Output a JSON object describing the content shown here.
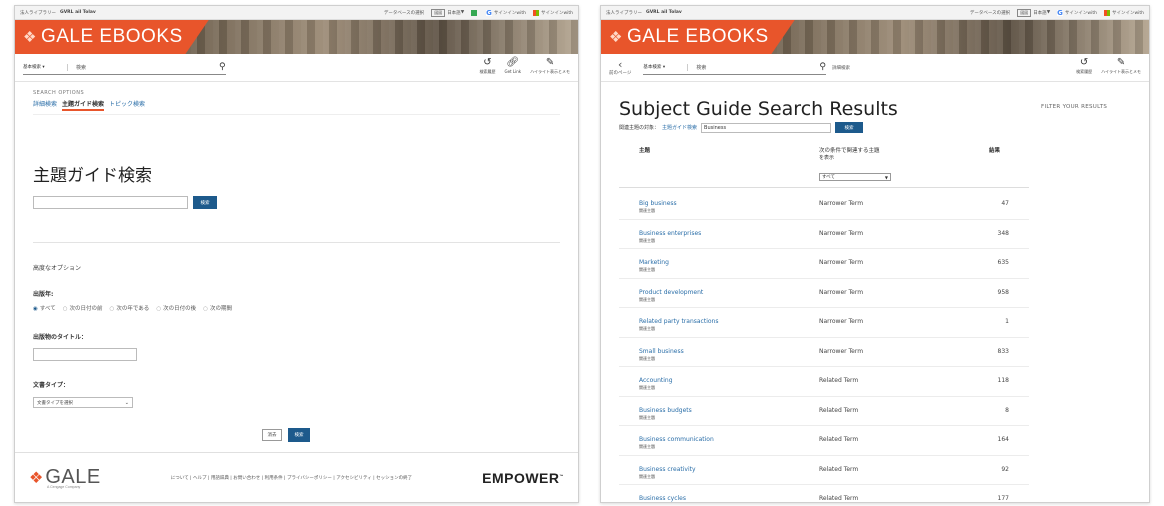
{
  "topbar": {
    "library": "法人ライブラリー",
    "org": "GVRL ail Tolav",
    "db_select": "データベースの選択",
    "lang_icon": "図図",
    "lang": "日本語",
    "signin_google": "サインインwith",
    "signin_ms": "サインインwith"
  },
  "brand": {
    "name": "GALE EBOOKS"
  },
  "left": {
    "search": {
      "type": "基本検索",
      "placeholder": "検索"
    },
    "tools": [
      {
        "icon": "history-icon",
        "label": "検索履歴"
      },
      {
        "icon": "link-icon",
        "label": "Get Link"
      },
      {
        "icon": "pen-icon",
        "label": "ハイライト表示とメモ"
      }
    ],
    "search_options": {
      "caption": "SEARCH OPTIONS",
      "tabs": [
        "詳細検索",
        "主題ガイド検索",
        "トピック検索"
      ],
      "active_tab": 1
    },
    "page_title": "主題ガイド検索",
    "search_button": "検索",
    "advanced_options": "高度なオプション",
    "pub_date": {
      "label": "出版年:",
      "options": [
        "すべて",
        "次の日付の前",
        "次の年である",
        "次の日付の後",
        "次の期間"
      ],
      "selected": 0
    },
    "pub_title_label": "出版物のタイトル：",
    "doc_type": {
      "label": "文書タイプ：",
      "selected": "文書タイプを選択"
    },
    "cancel": "消去",
    "submit": "検索"
  },
  "footer": {
    "logo": "GALE",
    "sub": "A Cengage Company",
    "links": "について | ヘルプ | 用語辞典 | お問い合わせ | 利用条件 | プライバシーポリシー | アクセシビリティ | セッションの終了",
    "empower": "EMPOWER",
    "tm": "™"
  },
  "right": {
    "back": "前のページ",
    "search": {
      "type": "基本検索",
      "placeholder": "検索"
    },
    "advanced": "詳細検索",
    "tools": [
      {
        "icon": "history-icon",
        "label": "検索履歴"
      },
      {
        "icon": "pen-icon",
        "label": "ハイライト表示とメモ"
      }
    ],
    "title": "Subject Guide Search Results",
    "filter": "FILTER YOUR RESULTS",
    "query_label": "関連主題の対象：",
    "query_tab": "主題ガイド検索",
    "query_value": "Business",
    "search_button": "検索",
    "columns": {
      "subject": "主題",
      "filter_line1": "次の条件で関連する主題",
      "filter_line2": "を表示",
      "filter_select": "すべて",
      "results": "結果"
    },
    "rows": [
      {
        "subject": "Big business",
        "type": "関連主題",
        "relation": "Narrower Term",
        "count": "47"
      },
      {
        "subject": "Business enterprises",
        "type": "関連主題",
        "relation": "Narrower Term",
        "count": "348"
      },
      {
        "subject": "Marketing",
        "type": "関連主題",
        "relation": "Narrower Term",
        "count": "635"
      },
      {
        "subject": "Product development",
        "type": "関連主題",
        "relation": "Narrower Term",
        "count": "958"
      },
      {
        "subject": "Related party transactions",
        "type": "関連主題",
        "relation": "Narrower Term",
        "count": "1"
      },
      {
        "subject": "Small business",
        "type": "関連主題",
        "relation": "Narrower Term",
        "count": "833"
      },
      {
        "subject": "Accounting",
        "type": "関連主題",
        "relation": "Related Term",
        "count": "118"
      },
      {
        "subject": "Business budgets",
        "type": "関連主題",
        "relation": "Related Term",
        "count": "8"
      },
      {
        "subject": "Business communication",
        "type": "関連主題",
        "relation": "Related Term",
        "count": "164"
      },
      {
        "subject": "Business creativity",
        "type": "関連主題",
        "relation": "Related Term",
        "count": "92"
      },
      {
        "subject": "Business cycles",
        "type": "関連主題",
        "relation": "Related Term",
        "count": "177"
      }
    ]
  }
}
